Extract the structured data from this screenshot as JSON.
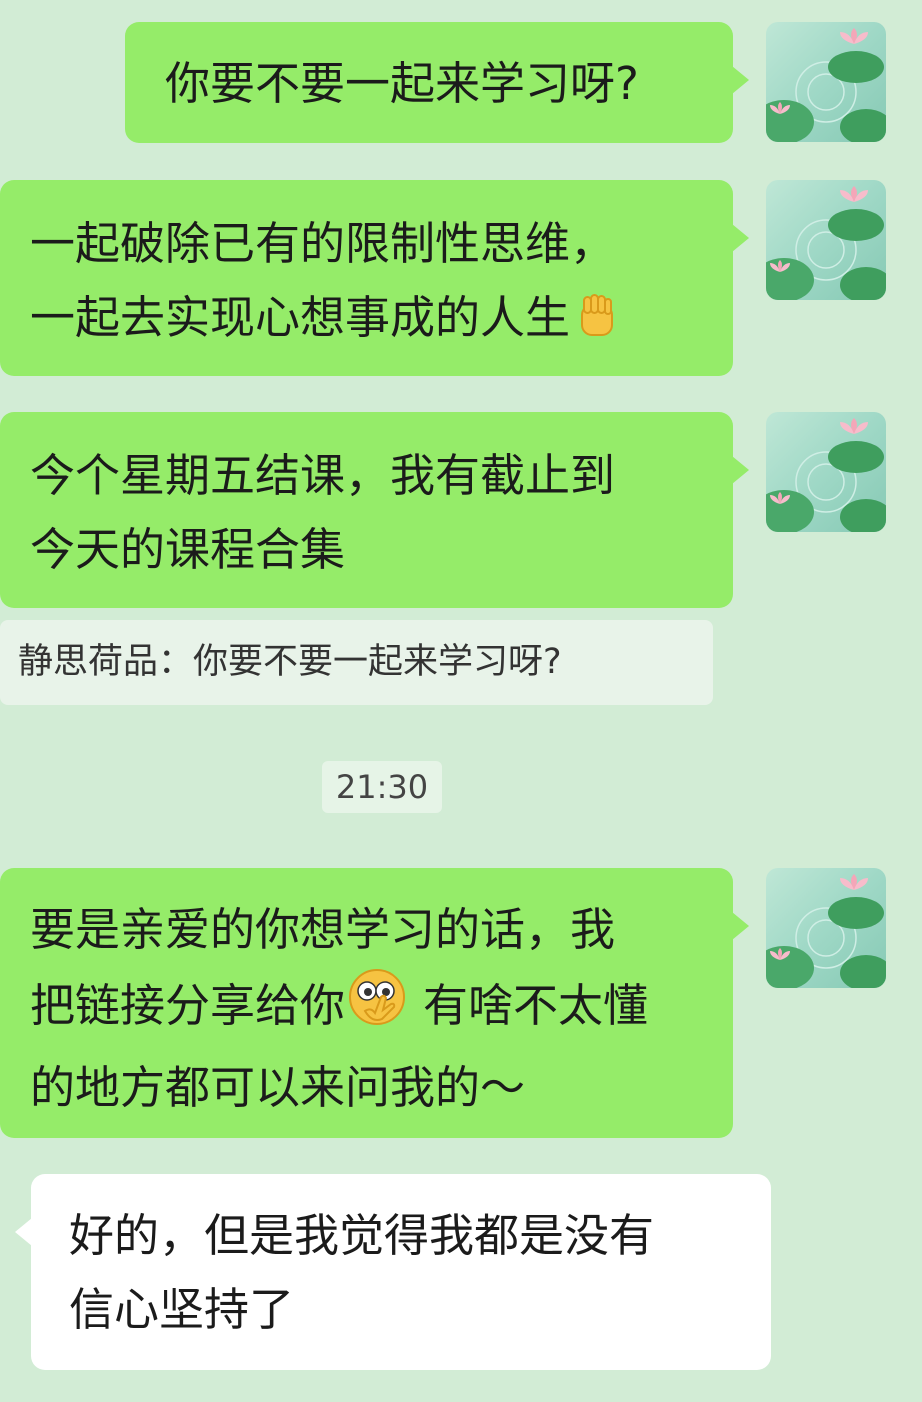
{
  "messages": [
    {
      "lines": [
        "你要不要一起来学习呀?"
      ]
    },
    {
      "lines": [
        "一起破除已有的限制性思维，",
        "一起去实现心想事成的人生"
      ],
      "emoji": "raised-fist-emoji"
    },
    {
      "lines": [
        "今个星期五结课，我有截止到",
        "今天的课程合集"
      ]
    },
    {
      "lines": [
        "要是亲爱的你想学习的话，我",
        "把链接分享给你",
        "有啥不太懂",
        "的地方都可以来问我的～"
      ],
      "emoji": "thinking-hand-emoji"
    },
    {
      "lines": [
        "好的，但是我觉得我都是没有",
        "信心坚持了"
      ]
    }
  ],
  "quote": {
    "sender": "静思荷品",
    "separator": "：",
    "text": "你要不要一起来学习呀?"
  },
  "timestamp": "21:30",
  "colors": {
    "background": "#d2ecd5",
    "outgoing_bubble": "#95ec69",
    "incoming_bubble": "#ffffff"
  }
}
